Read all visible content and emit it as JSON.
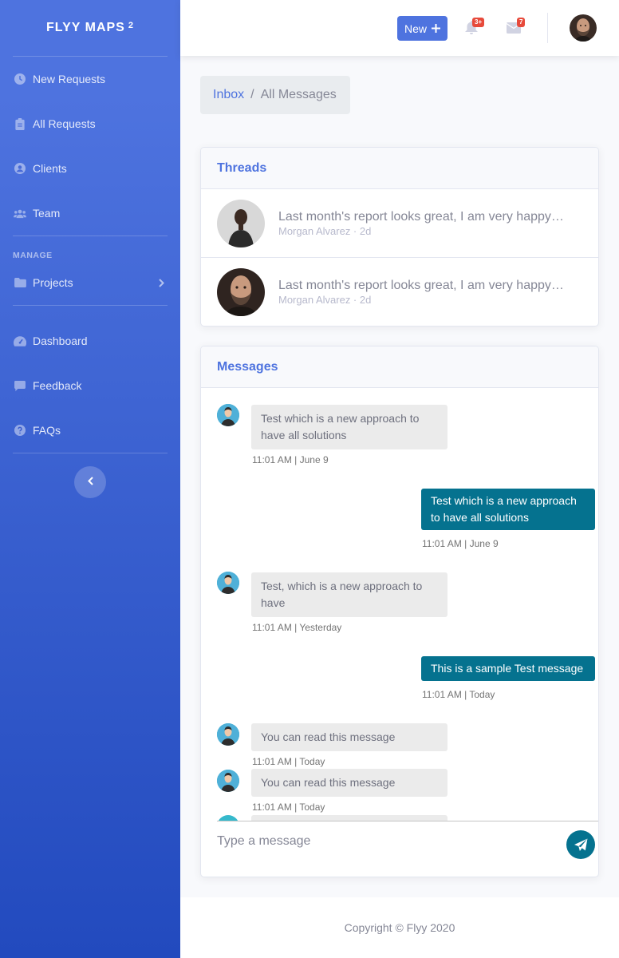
{
  "brand": {
    "name": "FLYY MAPS",
    "sup": "2"
  },
  "sidebar": {
    "items": [
      {
        "label": "New Requests",
        "icon": "clock-icon"
      },
      {
        "label": "All Requests",
        "icon": "clipboard-icon"
      },
      {
        "label": "Clients",
        "icon": "user-circle-icon"
      },
      {
        "label": "Team",
        "icon": "users-icon"
      }
    ],
    "manage_heading": "MANAGE",
    "projects_label": "Projects",
    "items2": [
      {
        "label": "Dashboard",
        "icon": "tachometer-icon"
      },
      {
        "label": "Feedback",
        "icon": "comment-icon"
      },
      {
        "label": "FAQs",
        "icon": "question-circle-icon"
      }
    ]
  },
  "topbar": {
    "new_label": "New",
    "alerts_badge": "3+",
    "messages_badge": "7"
  },
  "breadcrumb": {
    "inbox": "Inbox",
    "separator": "/",
    "current": "All Messages"
  },
  "threads": {
    "title": "Threads",
    "items": [
      {
        "message": "Last month's report looks great, I am very happy with the progress so far",
        "meta": "Morgan Alvarez · 2d"
      },
      {
        "message": "Last month's report looks great, I am very happy with the progress so far",
        "meta": "Morgan Alvarez · 2d"
      }
    ]
  },
  "messages": {
    "title": "Messages",
    "items": [
      {
        "text": "Test which is a new approach to have all solutions",
        "time": "11:01 AM | June 9"
      },
      {
        "text": "Test which is a new approach to have all solutions",
        "time": "11:01 AM | June 9"
      },
      {
        "text": "Test, which is a new approach to have",
        "time": "11:01 AM | Yesterday"
      },
      {
        "text": "This is a sample Test message",
        "time": "11:01 AM | Today"
      },
      {
        "text": "You can read this message",
        "time": "11:01 AM | Today"
      },
      {
        "text": "You can read this message",
        "time": "11:01 AM | Today"
      }
    ],
    "input_placeholder": "Type a message"
  },
  "footer": {
    "copyright": "Copyright © Flyy 2020"
  },
  "colors": {
    "primary": "#4e73df",
    "sent_bubble": "#05728f",
    "badge": "#e74a3b"
  }
}
